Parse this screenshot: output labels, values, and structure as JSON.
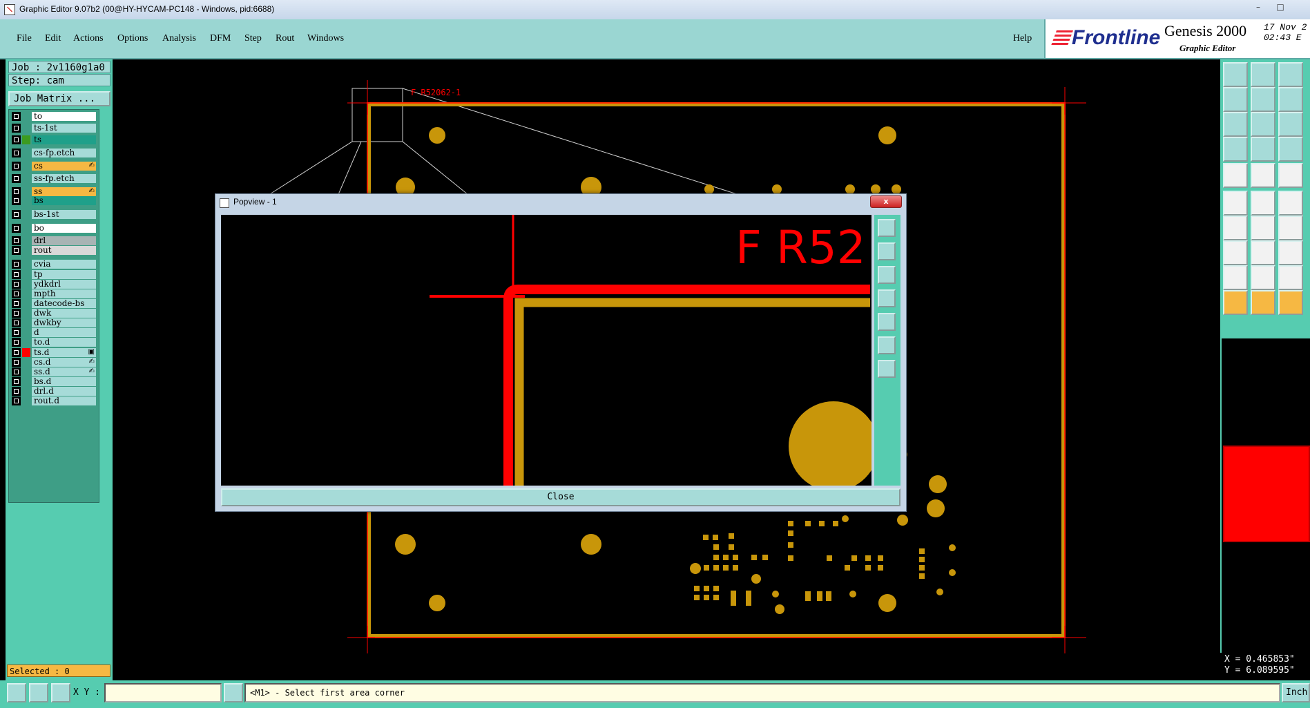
{
  "window": {
    "title": "Graphic Editor 9.07b2 (00@HY-HYCAM-PC148 - Windows, pid:6688)",
    "minimize": "–",
    "maximize": "□"
  },
  "menu": [
    "File",
    "Edit",
    "Actions",
    "Options",
    "Analysis",
    "DFM",
    "Step",
    "Rout",
    "Windows"
  ],
  "help": "Help",
  "brand": {
    "logo": "Frontline",
    "product": "Genesis 2000",
    "subtitle": "Graphic Editor",
    "date": "17 Nov 2",
    "time": "02:43 E"
  },
  "job": {
    "job_label": "Job : 2v1160g1a0",
    "step_label": "Step: cam",
    "matrix_button": "Job Matrix ..."
  },
  "layers": [
    {
      "name": "to",
      "bg": "#ffffff",
      "swatch": ""
    },
    {
      "name": "ts-1st",
      "bg": "#a6dbd8",
      "swatch": ""
    },
    {
      "name": "ts",
      "bg": "#1fa08a",
      "swatch": "#3c9b1f"
    },
    {
      "name": "cs-fp.etch",
      "bg": "#a6dbd8",
      "swatch": ""
    },
    {
      "name": "cs",
      "bg": "#f6b843",
      "swatch": "",
      "mark": "✍"
    },
    {
      "name": "ss-fp.etch",
      "bg": "#a6dbd8",
      "swatch": ""
    },
    {
      "name": "ss",
      "bg": "#f6b843",
      "swatch": "",
      "mark": "✍"
    },
    {
      "name": "bs",
      "bg": "#1fa08a",
      "swatch": ""
    },
    {
      "name": "bs-1st",
      "bg": "#a6dbd8",
      "swatch": ""
    },
    {
      "name": "bo",
      "bg": "#ffffff",
      "swatch": ""
    },
    {
      "name": "drl",
      "bg": "#a8b4b4",
      "swatch": ""
    },
    {
      "name": "rout",
      "bg": "#d9d9d9",
      "swatch": ""
    },
    {
      "name": "cvia",
      "bg": "#a6dbd8",
      "swatch": ""
    },
    {
      "name": "tp",
      "bg": "#a6dbd8",
      "swatch": ""
    },
    {
      "name": "ydkdrl",
      "bg": "#a6dbd8",
      "swatch": ""
    },
    {
      "name": "mpth",
      "bg": "#a6dbd8",
      "swatch": ""
    },
    {
      "name": "datecode-bs",
      "bg": "#a6dbd8",
      "swatch": ""
    },
    {
      "name": "dwk",
      "bg": "#a6dbd8",
      "swatch": ""
    },
    {
      "name": "dwkby",
      "bg": "#a6dbd8",
      "swatch": ""
    },
    {
      "name": "d",
      "bg": "#a6dbd8",
      "swatch": ""
    },
    {
      "name": "to.d",
      "bg": "#a6dbd8",
      "swatch": ""
    },
    {
      "name": "ts.d",
      "bg": "#a6dbd8",
      "swatch": "#ff0000",
      "mark": "▣"
    },
    {
      "name": "cs.d",
      "bg": "#a6dbd8",
      "swatch": "",
      "mark": "✍"
    },
    {
      "name": "ss.d",
      "bg": "#a6dbd8",
      "swatch": "",
      "mark": "✍"
    },
    {
      "name": "bs.d",
      "bg": "#a6dbd8",
      "swatch": ""
    },
    {
      "name": "drl.d",
      "bg": "#a6dbd8",
      "swatch": ""
    },
    {
      "name": "rout.d",
      "bg": "#a6dbd8",
      "swatch": ""
    }
  ],
  "selected": "Selected : 0",
  "canvas": {
    "component_label": "F R52062-1"
  },
  "popview": {
    "title": "Popview - 1",
    "label_text": "F R52",
    "close_label": "Close",
    "close_x": "x"
  },
  "coords": {
    "x": "X = 0.465853\"",
    "y": "Y = 6.089595\""
  },
  "status": {
    "xy_label": "X Y :",
    "xy_value": "",
    "message": "<M1> - Select first area corner",
    "unit": "Inch"
  },
  "colors": {
    "teal": "#56ccb0",
    "light_teal": "#a6dbd8",
    "orange": "#f6b843",
    "copper": "#c8960a",
    "red": "#ff0000"
  }
}
